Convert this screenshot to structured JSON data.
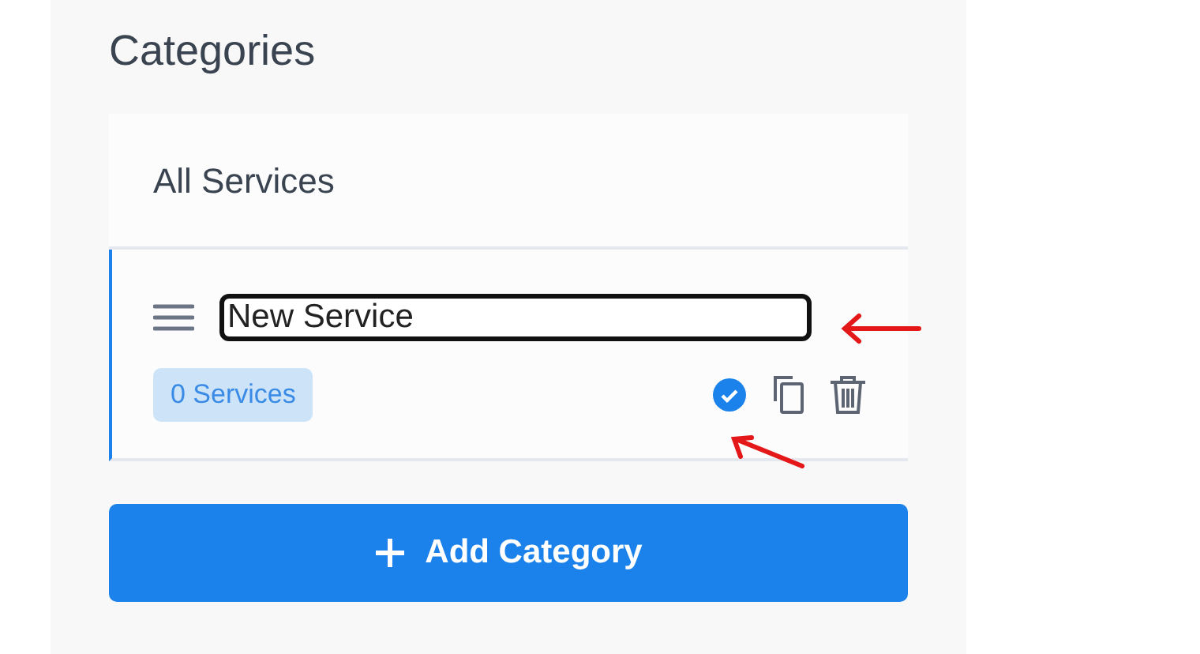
{
  "title": "Categories",
  "categories": [
    {
      "kind": "all",
      "label": "All Services",
      "selected": false
    },
    {
      "kind": "editable",
      "value": "New Service",
      "count": "0 Services",
      "selected": true
    }
  ],
  "add_button": {
    "label": "Add Category"
  }
}
